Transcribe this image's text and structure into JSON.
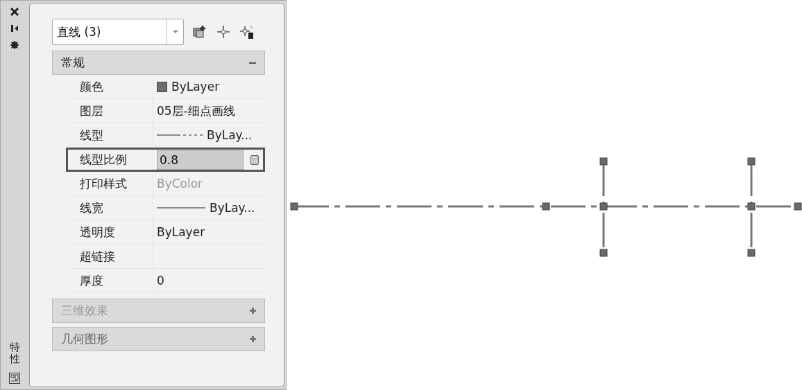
{
  "palette_title": "特性",
  "selection": {
    "value": "直线 (3)"
  },
  "sections": [
    {
      "title": "常规",
      "expanded": true,
      "rows": [
        {
          "label": "颜色",
          "kind": "swatch",
          "value": "ByLayer",
          "color": "#6e6e6e",
          "selected": false,
          "disabled": false
        },
        {
          "label": "图层",
          "kind": "text",
          "value": "05层-细点画线",
          "selected": false,
          "disabled": false
        },
        {
          "label": "线型",
          "kind": "linetype",
          "value": "ByLay...",
          "selected": false,
          "disabled": false
        },
        {
          "label": "线型比例",
          "kind": "edit",
          "value": "0.8",
          "selected": true,
          "disabled": false
        },
        {
          "label": "打印样式",
          "kind": "text",
          "value": "ByColor",
          "selected": false,
          "disabled": true
        },
        {
          "label": "线宽",
          "kind": "lineweight",
          "value": "ByLay...",
          "selected": false,
          "disabled": false
        },
        {
          "label": "透明度",
          "kind": "text",
          "value": "ByLayer",
          "selected": false,
          "disabled": false
        },
        {
          "label": "超链接",
          "kind": "text",
          "selected": false
        },
        {
          "label": "厚度",
          "kind": "text",
          "value": "0",
          "selected": false,
          "disabled": false
        }
      ]
    },
    {
      "title": "三维效果",
      "expanded": false,
      "disabled": true
    },
    {
      "title": "几何图形",
      "expanded": false,
      "disabled": false
    }
  ]
}
